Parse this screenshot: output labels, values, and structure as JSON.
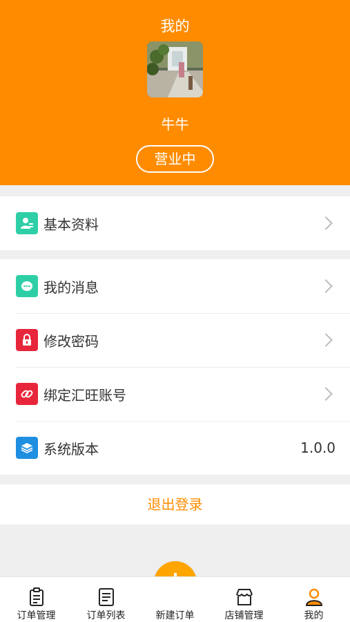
{
  "header": {
    "title": "我的",
    "username": "牛牛",
    "status": "营业中",
    "avatar_icon": "profile-photo"
  },
  "profile_group": [
    {
      "label": "基本资料",
      "icon": "profile-card-icon",
      "color": "#2ecfa6"
    }
  ],
  "settings_group": [
    {
      "label": "我的消息",
      "icon": "message-icon",
      "color": "#2ecfa6"
    },
    {
      "label": "修改密码",
      "icon": "lock-icon",
      "color": "#e8263b"
    },
    {
      "label": "绑定汇旺账号",
      "icon": "link-icon",
      "color": "#e8263b"
    },
    {
      "label": "系统版本",
      "icon": "layers-icon",
      "color": "#1e8fe0",
      "value": "1.0.0"
    }
  ],
  "logout": {
    "label": "退出登录"
  },
  "tabbar": {
    "items": [
      {
        "label": "订单管理",
        "icon": "clipboard-icon"
      },
      {
        "label": "订单列表",
        "icon": "document-icon"
      },
      {
        "label": "新建订单",
        "icon": "plus-icon"
      },
      {
        "label": "店铺管理",
        "icon": "store-icon"
      },
      {
        "label": "我的",
        "icon": "person-icon",
        "active_color": "#ff8c00"
      }
    ]
  },
  "colors": {
    "brand": "#ff8c00",
    "fab": "#ffa500"
  }
}
